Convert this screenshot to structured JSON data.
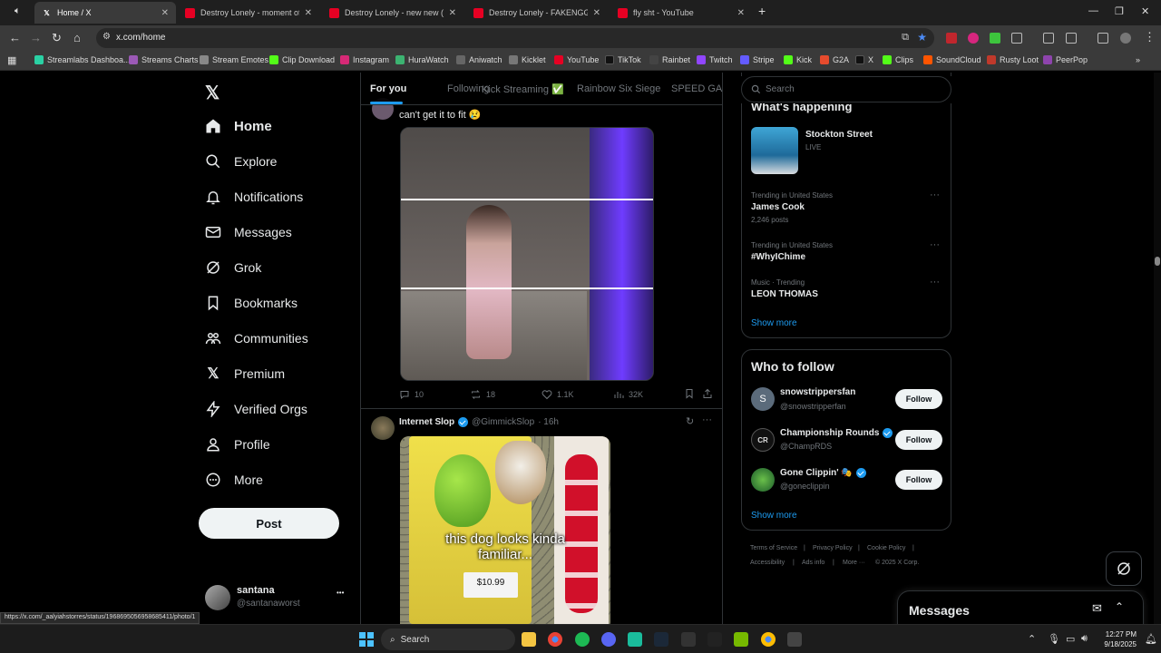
{
  "browser": {
    "tabs": [
      {
        "title": "Home / X",
        "icon": "x-logo"
      },
      {
        "title": "Destroy Lonely - moment of sile",
        "icon": "youtube"
      },
      {
        "title": "Destroy Lonely - new new (Offi",
        "icon": "youtube"
      },
      {
        "title": "Destroy Lonely - FAKENGGA",
        "icon": "youtube"
      },
      {
        "title": "fly sht - YouTube",
        "icon": "youtube"
      }
    ],
    "new_tab": "+",
    "url": "x.com/home",
    "bookmarks": [
      "Streamlabs Dashboa...",
      "Streams Charts",
      "Stream Emotes",
      "Clip Download",
      "Instagram",
      "HuraWatch",
      "Aniwatch",
      "Kicklet",
      "YouTube",
      "TikTok",
      "Rainbet",
      "Twitch",
      "Stripe",
      "Kick",
      "G2A",
      "X",
      "Clips",
      "SoundCloud",
      "Rusty Loot",
      "PeerPop"
    ]
  },
  "sidebar": {
    "items": [
      {
        "label": "Home",
        "icon": "home-icon"
      },
      {
        "label": "Explore",
        "icon": "search-icon"
      },
      {
        "label": "Notifications",
        "icon": "bell-icon"
      },
      {
        "label": "Messages",
        "icon": "mail-icon"
      },
      {
        "label": "Grok",
        "icon": "grok-icon"
      },
      {
        "label": "Bookmarks",
        "icon": "bookmark-icon"
      },
      {
        "label": "Communities",
        "icon": "people-icon"
      },
      {
        "label": "Premium",
        "icon": "x-logo-icon"
      },
      {
        "label": "Verified Orgs",
        "icon": "lightning-icon"
      },
      {
        "label": "Profile",
        "icon": "person-icon"
      },
      {
        "label": "More",
        "icon": "more-circle-icon"
      }
    ],
    "post_label": "Post",
    "account_name": "santana",
    "account_handle": "@santanaworst",
    "account_more": "•••"
  },
  "feed": {
    "tabs": [
      "For you",
      "Following",
      "Kick Streaming ✅",
      "Rainbow Six Siege",
      "SPEED GANG"
    ],
    "post1": {
      "text": "can't get it to fit 😢",
      "replies": "10",
      "reposts": "18",
      "likes": "1.1K",
      "views": "32K"
    },
    "post2": {
      "name": "Internet Slop",
      "handle": "@GimmickSlop",
      "time": "· 16h",
      "caption_line1": "this dog looks kinda",
      "caption_line2": "familiar...",
      "price": "$10.99"
    }
  },
  "right": {
    "search_placeholder": "Search",
    "whats_happening": "What's happening",
    "live_title": "Stockton Street",
    "live_label": "LIVE",
    "trends": [
      {
        "meta": "Trending in United States",
        "name": "James Cook",
        "count": "2,246 posts"
      },
      {
        "meta": "Trending in United States",
        "name": "#WhyIChime",
        "count": ""
      },
      {
        "meta": "Music · Trending",
        "name": "LEON THOMAS",
        "count": ""
      }
    ],
    "show_more": "Show more",
    "who_to_follow": "Who to follow",
    "follow_label": "Follow",
    "accounts": [
      {
        "name": "snowstrippersfan",
        "handle": "@snowstripperfan",
        "verified": false
      },
      {
        "name": "Championship Rounds",
        "handle": "@ChampRDS",
        "verified": true
      },
      {
        "name": "Gone Clippin' 🎭",
        "handle": "@goneclippin",
        "verified": true
      }
    ],
    "footer": [
      "Terms of Service",
      "|",
      "Privacy Policy",
      "|",
      "Cookie Policy",
      "|",
      "Accessibility",
      "|",
      "Ads info",
      "|",
      "More ···",
      "© 2025 X Corp."
    ],
    "messages_title": "Messages"
  },
  "status_url": "https://x.com/_aalyiahstorres/status/1968695056958685411/photo/1",
  "taskbar": {
    "search": "Search",
    "time": "12:27 PM",
    "date": "9/18/2025"
  },
  "colors": {
    "accent": "#1d9bf0",
    "bg": "#000000",
    "border": "#2f3336"
  }
}
